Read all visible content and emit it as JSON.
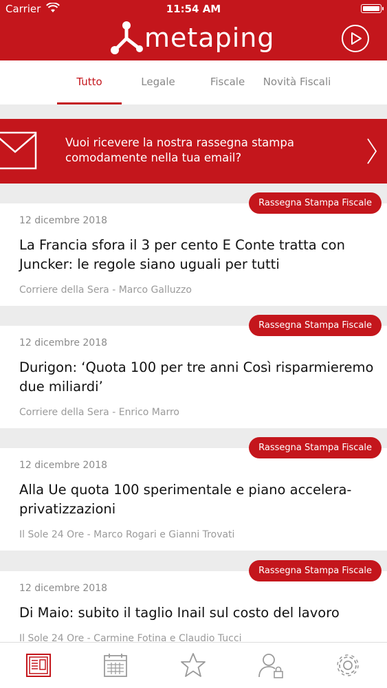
{
  "status_bar": {
    "carrier": "Carrier",
    "time": "11:54 AM"
  },
  "header": {
    "app_name": "metaping"
  },
  "tabs": [
    {
      "label": "Tutto",
      "active": true
    },
    {
      "label": "Legale",
      "active": false
    },
    {
      "label": "Fiscale",
      "active": false
    },
    {
      "label": "Novità Fiscali",
      "active": false
    }
  ],
  "banner": {
    "line1": "Vuoi ricevere la nostra rassegna stampa",
    "line2": "comodamente nella tua email?"
  },
  "articles": [
    {
      "badge": "Rassegna Stampa Fiscale",
      "date": "12 dicembre 2018",
      "title": "La Francia sfora il 3 per cento E Conte tratta con Juncker: le regole siano uguali per tutti",
      "source": "Corriere della Sera - Marco Galluzzo"
    },
    {
      "badge": "Rassegna Stampa Fiscale",
      "date": "12 dicembre 2018",
      "title": "Durigon: ‘Quota 100 per tre anni Così risparmieremo due miliardi’",
      "source": "Corriere della Sera - Enrico Marro"
    },
    {
      "badge": "Rassegna Stampa Fiscale",
      "date": "12 dicembre 2018",
      "title": "Alla Ue quota 100 sperimentale e piano accelera-privatizzazioni",
      "source": "Il Sole 24 Ore - Marco Rogari e Gianni Trovati"
    },
    {
      "badge": "Rassegna Stampa Fiscale",
      "date": "12 dicembre 2018",
      "title": "Di Maio: subito il taglio Inail sul costo del lavoro",
      "source": "Il Sole 24 Ore - Carmine Fotina e Claudio Tucci"
    }
  ],
  "bottom_nav": [
    {
      "icon": "newspaper-icon",
      "active": true
    },
    {
      "icon": "calendar-icon",
      "active": false
    },
    {
      "icon": "star-icon",
      "active": false
    },
    {
      "icon": "user-lock-icon",
      "active": false
    },
    {
      "icon": "gear-icon",
      "active": false
    }
  ],
  "colors": {
    "brand": "#c4161c",
    "inactive_icon": "#9a9a9a"
  }
}
